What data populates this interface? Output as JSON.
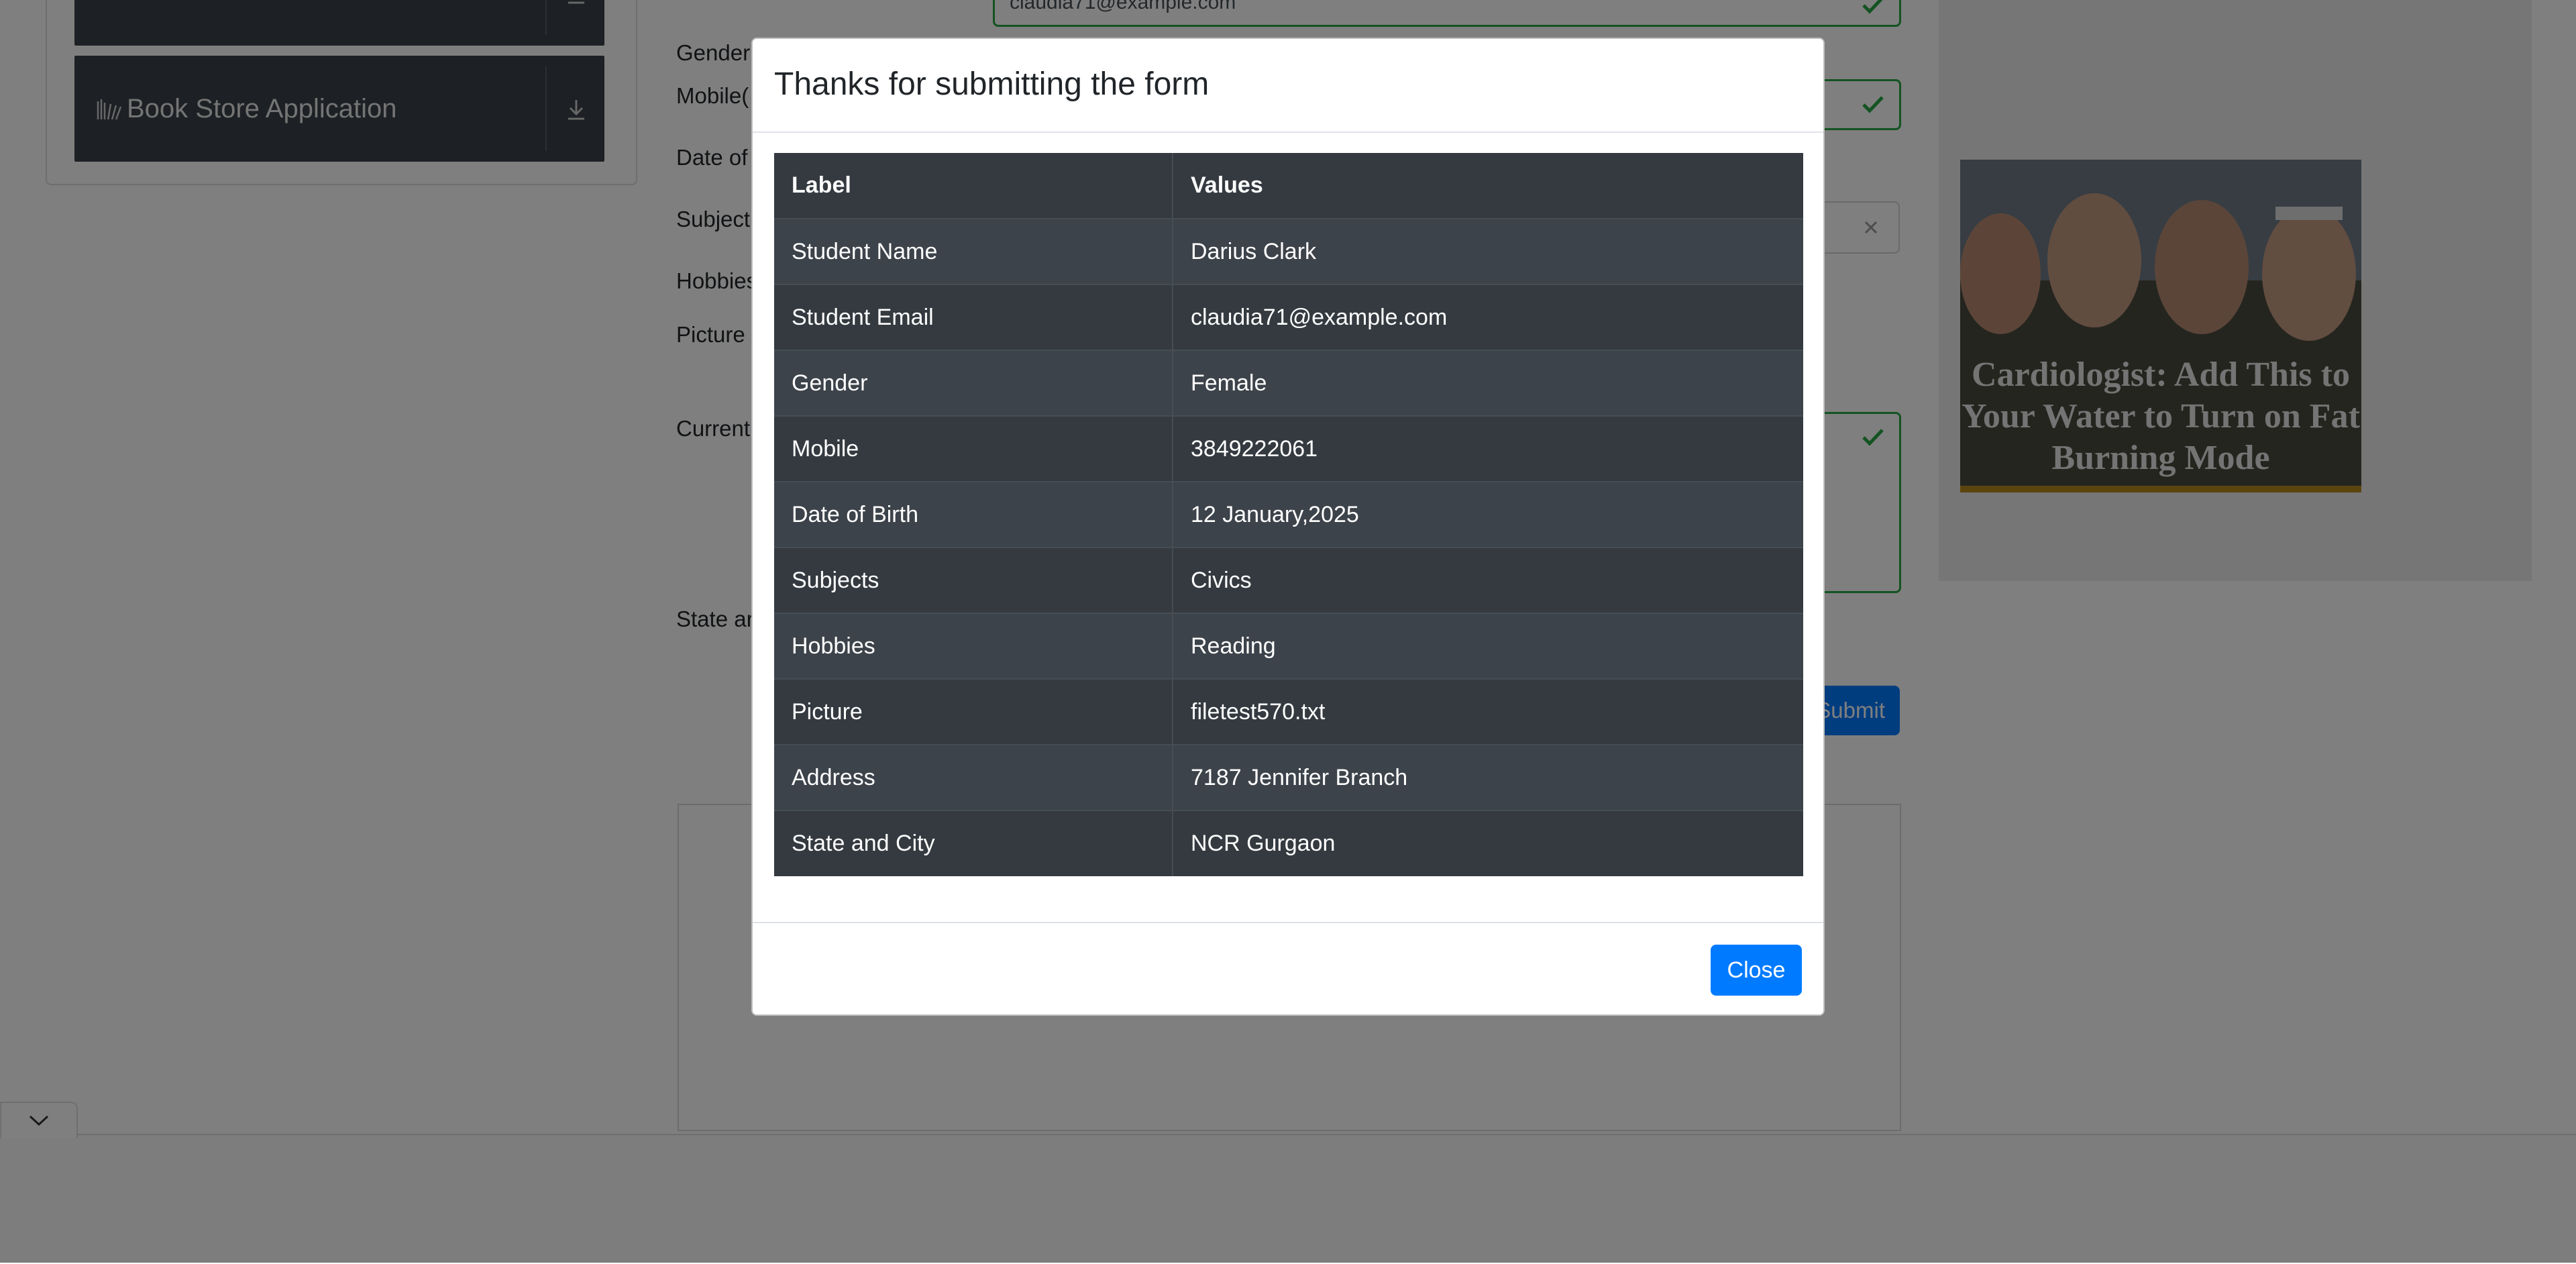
{
  "sidebar": {
    "items": [
      {
        "label": ""
      },
      {
        "label": "Book Store Application"
      }
    ]
  },
  "form": {
    "labels": {
      "gender": "Gender",
      "mobile": "Mobile(",
      "dob": "Date of",
      "subjects": "Subject",
      "hobbies": "Hobbies",
      "picture": "Picture",
      "address": "Current",
      "state_city": "State ar"
    },
    "email_value": "claudia71@example.com",
    "submit_label": "Submit"
  },
  "ad": {
    "headline": "Cardiologist: Add This to Your Water to Turn on Fat Burning Mode"
  },
  "modal": {
    "title": "Thanks for submitting the form",
    "columns": [
      "Label",
      "Values"
    ],
    "rows": [
      {
        "label": "Student Name",
        "value": "Darius Clark"
      },
      {
        "label": "Student Email",
        "value": "claudia71@example.com"
      },
      {
        "label": "Gender",
        "value": "Female"
      },
      {
        "label": "Mobile",
        "value": "3849222061"
      },
      {
        "label": "Date of Birth",
        "value": "12 January,2025"
      },
      {
        "label": "Subjects",
        "value": "Civics"
      },
      {
        "label": "Hobbies",
        "value": "Reading"
      },
      {
        "label": "Picture",
        "value": "filetest570.txt"
      },
      {
        "label": "Address",
        "value": "7187 Jennifer Branch"
      },
      {
        "label": "State and City",
        "value": "NCR Gurgaon"
      }
    ],
    "close_label": "Close"
  },
  "colors": {
    "primary": "#007bff",
    "valid": "#28a745",
    "table_dark": "#343a40",
    "overlay": "rgba(0,0,0,0.5)"
  }
}
